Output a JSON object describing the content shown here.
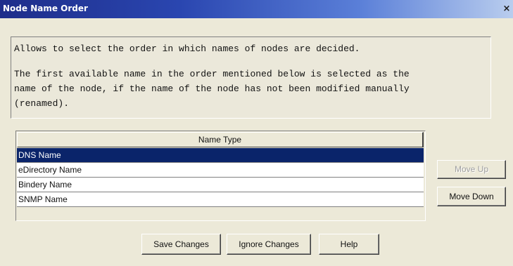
{
  "window": {
    "title": "Node Name Order",
    "close_glyph": "×"
  },
  "description": {
    "line1": "Allows to select the order in which names of nodes are decided.",
    "line2": "The first available name in the order mentioned below is selected as the",
    "line3": "name of the node, if the name of the node has not been modified manually",
    "line4": "(renamed)."
  },
  "table": {
    "header": "Name Type",
    "rows": [
      "DNS Name",
      "eDirectory Name",
      "Bindery Name",
      "SNMP Name"
    ],
    "selected_row": "DNS Name"
  },
  "side_buttons": {
    "move_up": "Move Up",
    "move_up_enabled": false,
    "move_down": "Move Down"
  },
  "footer_buttons": {
    "save": "Save Changes",
    "ignore": "Ignore Changes",
    "help": "Help"
  },
  "colors": {
    "title_bar": "#1e2d8a",
    "selection": "#0a246a",
    "dialog_background": "#ece9d8"
  }
}
